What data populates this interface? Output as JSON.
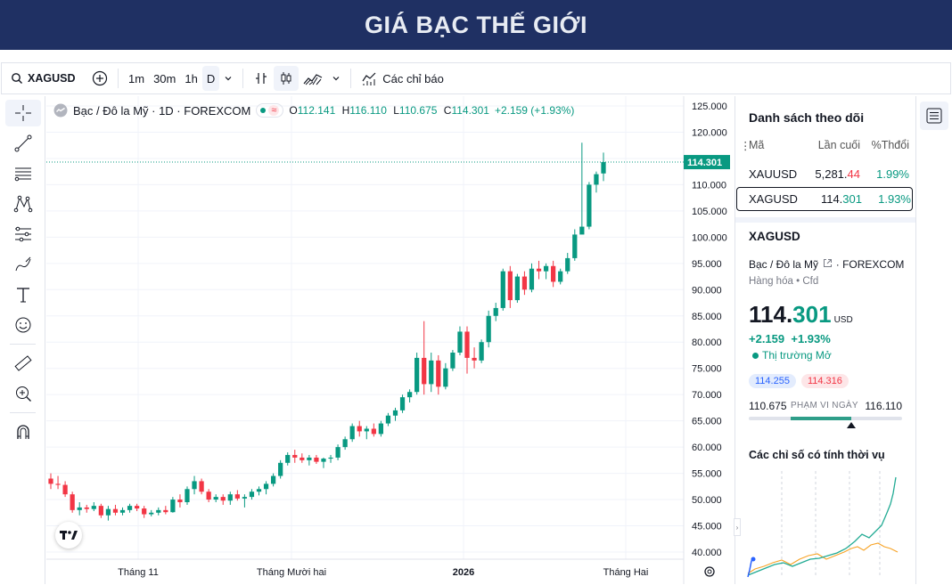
{
  "banner": {
    "title": "GIÁ BẠC THẾ GIỚI"
  },
  "toolbar": {
    "symbol": "XAGUSD",
    "intervals": [
      "1m",
      "30m",
      "1h",
      "D"
    ],
    "indicators_label": "Các chỉ báo"
  },
  "legend": {
    "title": "Bạc / Đô la Mỹ · 1D · FOREXCOM",
    "o_label": "O",
    "o_value": "112.141",
    "h_label": "H",
    "h_value": "116.110",
    "l_label": "L",
    "l_value": "110.675",
    "c_label": "C",
    "c_value": "114.301",
    "change": "+2.159 (+1.93%)"
  },
  "price_axis": {
    "labels": [
      "125.000",
      "120.000",
      "115.000",
      "110.000",
      "105.000",
      "100.000",
      "95.000",
      "90.000",
      "85.000",
      "80.000",
      "75.000",
      "70.000",
      "65.000",
      "60.000",
      "55.000",
      "50.000",
      "45.000",
      "40.000"
    ],
    "current_label": "114.301"
  },
  "time_axis": {
    "labels": [
      "Tháng 11",
      "Tháng Mười hai",
      "2026",
      "Tháng Hai"
    ]
  },
  "watchlist": {
    "title": "Danh sách theo dõi",
    "col_symbol": "Mã",
    "col_last": "Lần cuối",
    "col_change": "%Thđổi",
    "rows": [
      {
        "symbol": "XAUUSD",
        "last_main": "5,281.",
        "last_dec": "44",
        "change": "1.99%"
      },
      {
        "symbol": "XAGUSD",
        "last_main": "114.",
        "last_dec": "301",
        "change": "1.93%"
      }
    ]
  },
  "details": {
    "symbol": "XAGUSD",
    "name": "Bạc / Đô la Mỹ",
    "exchange": "FOREXCOM",
    "type": "Hàng hóa",
    "subtype": "Cfd",
    "price_main": "114.",
    "price_dec": "301",
    "currency": "USD",
    "change": "+2.159",
    "change_pct": "+1.93%",
    "market_status": "Thị trường Mở",
    "bid": "114.255",
    "ask": "114.316",
    "range_low": "110.675",
    "range_label": "PHẠM VI NGÀY",
    "range_high": "116.110",
    "range_position": 0.67,
    "seasonal_title": "Các chỉ số có tính thời vụ"
  },
  "colors": {
    "up": "#089981",
    "down": "#f23645",
    "banner": "#1f3063",
    "accent": "#2962ff"
  },
  "chart_data": {
    "type": "candlestick",
    "ylim": [
      40,
      125
    ],
    "candles": [
      [
        54.0,
        55.0,
        52.0,
        53.0
      ],
      [
        53.0,
        54.5,
        52.0,
        52.8
      ],
      [
        52.8,
        53.5,
        50.5,
        51.0
      ],
      [
        51.0,
        51.5,
        47.5,
        48.0
      ],
      [
        48.0,
        49.5,
        47.0,
        48.5
      ],
      [
        48.5,
        49.0,
        47.5,
        48.2
      ],
      [
        48.2,
        49.5,
        47.8,
        48.8
      ],
      [
        48.8,
        49.2,
        46.5,
        47.0
      ],
      [
        47.0,
        48.8,
        46.0,
        48.2
      ],
      [
        48.2,
        49.0,
        47.0,
        47.5
      ],
      [
        47.5,
        48.5,
        47.0,
        48.0
      ],
      [
        48.0,
        49.2,
        47.5,
        48.8
      ],
      [
        48.8,
        49.2,
        47.8,
        48.3
      ],
      [
        48.3,
        48.8,
        46.5,
        47.2
      ],
      [
        47.2,
        48.0,
        46.8,
        47.5
      ],
      [
        47.5,
        48.5,
        47.0,
        48.0
      ],
      [
        48.0,
        48.8,
        47.2,
        47.6
      ],
      [
        47.6,
        50.5,
        47.5,
        50.0
      ],
      [
        50.0,
        51.0,
        48.5,
        49.5
      ],
      [
        49.5,
        52.5,
        49.0,
        52.0
      ],
      [
        52.0,
        54.5,
        51.0,
        53.5
      ],
      [
        53.5,
        54.0,
        51.0,
        51.5
      ],
      [
        51.5,
        52.0,
        49.5,
        50.0
      ],
      [
        50.0,
        51.0,
        49.5,
        50.5
      ],
      [
        50.5,
        51.0,
        49.0,
        49.8
      ],
      [
        49.8,
        51.5,
        49.0,
        51.0
      ],
      [
        51.0,
        51.8,
        49.8,
        50.2
      ],
      [
        50.2,
        51.0,
        48.5,
        50.5
      ],
      [
        50.5,
        52.0,
        50.0,
        51.5
      ],
      [
        51.5,
        52.5,
        50.8,
        52.0
      ],
      [
        52.0,
        53.5,
        51.0,
        53.0
      ],
      [
        53.0,
        55.0,
        52.5,
        54.5
      ],
      [
        54.5,
        57.5,
        54.0,
        57.0
      ],
      [
        57.0,
        59.0,
        56.5,
        58.5
      ],
      [
        58.5,
        59.5,
        57.0,
        58.0
      ],
      [
        58.0,
        58.8,
        57.0,
        57.5
      ],
      [
        57.5,
        58.5,
        56.5,
        58.0
      ],
      [
        58.0,
        58.5,
        56.8,
        57.2
      ],
      [
        57.2,
        58.0,
        56.0,
        57.8
      ],
      [
        57.8,
        58.5,
        57.0,
        58.0
      ],
      [
        58.0,
        60.5,
        57.5,
        60.0
      ],
      [
        60.0,
        62.0,
        59.5,
        61.5
      ],
      [
        61.5,
        64.5,
        61.0,
        64.0
      ],
      [
        64.0,
        65.0,
        62.0,
        63.0
      ],
      [
        63.0,
        64.0,
        61.5,
        63.5
      ],
      [
        63.5,
        64.5,
        62.0,
        62.5
      ],
      [
        62.5,
        65.0,
        62.0,
        64.5
      ],
      [
        64.5,
        66.5,
        64.0,
        66.0
      ],
      [
        66.0,
        67.5,
        65.0,
        67.0
      ],
      [
        67.0,
        70.0,
        66.5,
        69.5
      ],
      [
        69.5,
        71.0,
        68.5,
        70.5
      ],
      [
        70.5,
        78.0,
        70.0,
        77.0
      ],
      [
        77.0,
        84.0,
        70.0,
        72.0
      ],
      [
        72.0,
        78.0,
        70.5,
        76.5
      ],
      [
        76.5,
        77.5,
        70.0,
        71.5
      ],
      [
        71.5,
        76.0,
        71.0,
        75.0
      ],
      [
        75.0,
        78.5,
        74.5,
        78.0
      ],
      [
        78.0,
        83.0,
        77.5,
        82.0
      ],
      [
        82.0,
        83.0,
        74.0,
        77.0
      ],
      [
        77.0,
        79.0,
        75.0,
        76.5
      ],
      [
        76.5,
        80.5,
        76.0,
        80.0
      ],
      [
        80.0,
        86.0,
        79.0,
        85.0
      ],
      [
        85.0,
        87.5,
        84.0,
        86.5
      ],
      [
        86.5,
        94.0,
        86.0,
        93.5
      ],
      [
        93.5,
        94.5,
        86.5,
        88.0
      ],
      [
        88.0,
        93.0,
        87.5,
        92.5
      ],
      [
        92.5,
        93.5,
        89.0,
        90.0
      ],
      [
        90.0,
        95.0,
        89.5,
        94.0
      ],
      [
        94.0,
        95.5,
        92.0,
        93.5
      ],
      [
        93.5,
        95.0,
        92.0,
        94.5
      ],
      [
        94.5,
        95.5,
        90.5,
        91.5
      ],
      [
        91.5,
        94.0,
        91.0,
        93.5
      ],
      [
        93.5,
        97.0,
        93.0,
        96.0
      ],
      [
        96.0,
        101.5,
        95.5,
        100.5
      ],
      [
        100.5,
        118.0,
        101.0,
        102.0
      ],
      [
        102.0,
        110.5,
        101.5,
        110.0
      ],
      [
        110.0,
        112.5,
        108.5,
        112.0
      ],
      [
        112.141,
        116.11,
        110.675,
        114.301
      ]
    ]
  }
}
